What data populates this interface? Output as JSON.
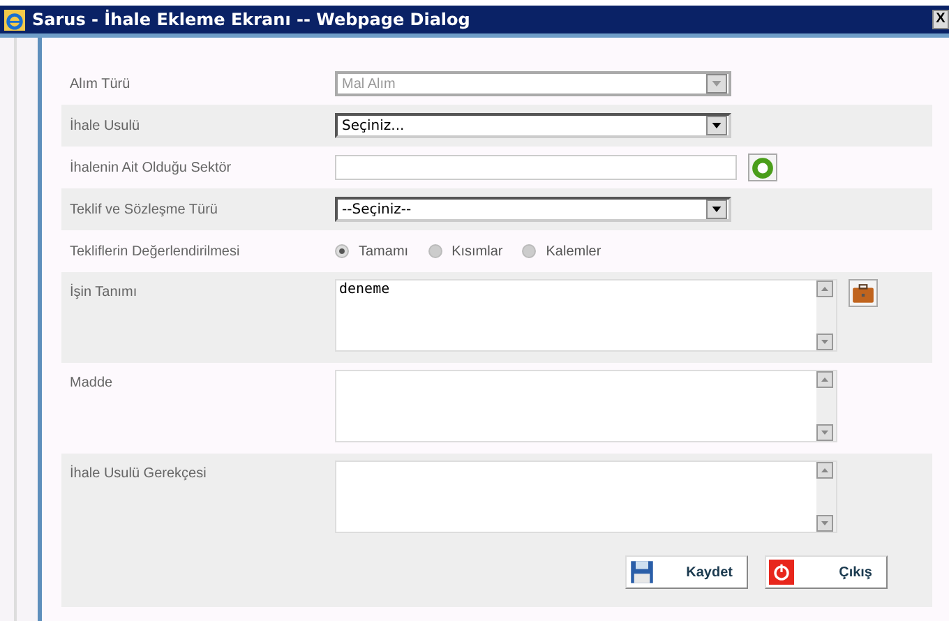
{
  "window": {
    "title": "Sarus - İhale Ekleme Ekranı -- Webpage Dialog",
    "close": "X"
  },
  "fields": [
    {
      "kind": "select",
      "label": "Alım Türü",
      "value": "Mal Alım",
      "disabled": true
    },
    {
      "kind": "select",
      "label": "İhale Usulü",
      "value": "Seçiniz...",
      "disabled": false
    },
    {
      "kind": "text",
      "label": "İhalenin Ait Olduğu Sektör"
    },
    {
      "kind": "select",
      "label": "Teklif ve Sözleşme Türü",
      "value": "--Seçiniz--",
      "disabled": false
    },
    {
      "kind": "radio",
      "label": "Tekliflerin Değerlendirilmesi",
      "options": [
        {
          "label": "Tamamı",
          "selected": true
        },
        {
          "label": "Kısımlar",
          "selected": false
        },
        {
          "label": "Kalemler",
          "selected": false
        }
      ]
    },
    {
      "kind": "textarea",
      "label": "İşin Tanımı",
      "value": "deneme",
      "action": {
        "kind": "briefcase"
      }
    },
    {
      "kind": "textarea",
      "label": "Madde"
    },
    {
      "kind": "textarea",
      "label": "İhale Usulü Gerekçesi"
    }
  ],
  "buttons": [
    {
      "kind": "save",
      "label": "Kaydet"
    },
    {
      "kind": "exit",
      "label": "Çıkış"
    }
  ]
}
